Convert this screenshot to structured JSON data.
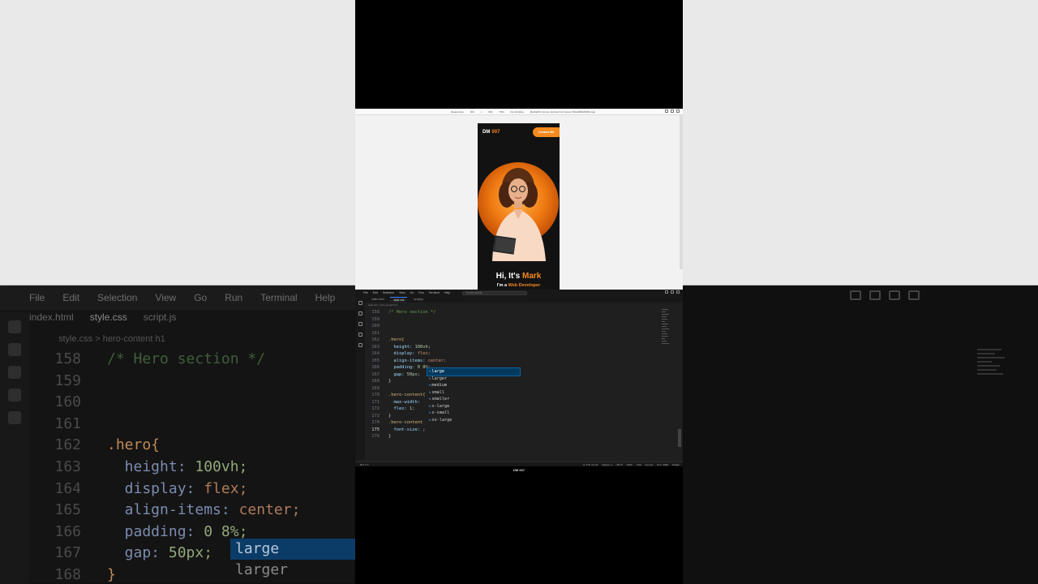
{
  "bg_zoom": {
    "menu": [
      "File",
      "Edit",
      "Selection",
      "View",
      "Go",
      "Run",
      "Terminal",
      "Help"
    ],
    "tabs": [
      "index.html",
      "style.css",
      "script.js"
    ],
    "crumb": "style.css > hero-content h1",
    "lines": [
      {
        "n": "158",
        "code": "/* Hero section */"
      },
      {
        "n": "159",
        "code": ""
      },
      {
        "n": "160",
        "code": ""
      },
      {
        "n": "161",
        "code": ""
      },
      {
        "n": "162",
        "code": ".hero{"
      },
      {
        "n": "163",
        "prop": "height",
        "val": "100vh;"
      },
      {
        "n": "164",
        "prop": "display",
        "val": "flex;"
      },
      {
        "n": "165",
        "prop": "align-items",
        "val": "center;"
      },
      {
        "n": "166",
        "prop": "padding",
        "val": "0 8%;"
      },
      {
        "n": "167",
        "prop": "gap",
        "val": "50px;"
      },
      {
        "n": "168",
        "code": "}"
      }
    ],
    "suggestions": [
      "large",
      "larger"
    ]
  },
  "devtools": {
    "device": "Responsive",
    "width": "364",
    "x": "×",
    "height": "834",
    "zoom": "75%",
    "throttle": "No throttling",
    "ua": "Mozilla/5.0 (Linux; Android 6.0; Nexus 5 Build/MRA58N) App"
  },
  "site": {
    "logo_prefix": "DM",
    "logo_highlight": "007",
    "contact_button": "Contact Me",
    "hero_title_prefix": "Hi, It's",
    "hero_title_name": "Mark",
    "hero_role_prefix": "I'm a",
    "hero_role_highlight": "Web Developer"
  },
  "editor": {
    "menu": [
      "File",
      "Edit",
      "Selection",
      "View",
      "Go",
      "Run",
      "Terminal",
      "Help"
    ],
    "search_placeholder": "Portfolio Website",
    "tabs": [
      "index.html",
      "style.css",
      "script.js"
    ],
    "crumb": "style.css > hero-content h1",
    "lines": [
      {
        "n": "158",
        "parts": [
          {
            "t": "cm",
            "v": "/* Hero section */"
          }
        ]
      },
      {
        "n": "159",
        "parts": []
      },
      {
        "n": "160",
        "parts": []
      },
      {
        "n": "161",
        "parts": []
      },
      {
        "n": "162",
        "parts": [
          {
            "t": "sel",
            "v": ".hero{"
          }
        ]
      },
      {
        "n": "163",
        "parts": [
          {
            "t": "prop",
            "v": "  height: "
          },
          {
            "t": "num",
            "v": "100vh;"
          }
        ]
      },
      {
        "n": "164",
        "parts": [
          {
            "t": "prop",
            "v": "  display: "
          },
          {
            "t": "val",
            "v": "flex;"
          }
        ]
      },
      {
        "n": "165",
        "parts": [
          {
            "t": "prop",
            "v": "  align-items: "
          },
          {
            "t": "val",
            "v": "center;"
          }
        ]
      },
      {
        "n": "166",
        "parts": [
          {
            "t": "prop",
            "v": "  padding: "
          },
          {
            "t": "num",
            "v": "0 8%;"
          }
        ]
      },
      {
        "n": "167",
        "parts": [
          {
            "t": "prop",
            "v": "  gap: "
          },
          {
            "t": "num",
            "v": "50px;"
          }
        ]
      },
      {
        "n": "168",
        "parts": [
          {
            "t": "",
            "v": "}"
          }
        ]
      },
      {
        "n": "169",
        "parts": []
      },
      {
        "n": "170",
        "parts": [
          {
            "t": "sel",
            "v": ".hero-content{"
          }
        ]
      },
      {
        "n": "171",
        "parts": [
          {
            "t": "prop",
            "v": "  max-width: "
          }
        ]
      },
      {
        "n": "172",
        "parts": [
          {
            "t": "prop",
            "v": "  flex: "
          },
          {
            "t": "num",
            "v": "1;"
          }
        ]
      },
      {
        "n": "173",
        "parts": [
          {
            "t": "",
            "v": "}"
          }
        ]
      },
      {
        "n": "174",
        "parts": [
          {
            "t": "sel",
            "v": ".hero-content"
          }
        ]
      },
      {
        "n": "175",
        "parts": [
          {
            "t": "prop",
            "v": "  font-size: "
          },
          {
            "t": "",
            "v": ";"
          }
        ],
        "current": true
      },
      {
        "n": "176",
        "parts": [
          {
            "t": "",
            "v": "}"
          }
        ]
      }
    ],
    "suggestions": [
      "large",
      "larger",
      "medium",
      "small",
      "smaller",
      "x-large",
      "x-small",
      "xx-large"
    ],
    "status_left": "⊗ 0 ⚠ 0",
    "status_right": [
      "Ln 175, Col 15",
      "Spaces: 4",
      "UTF-8",
      "CRLF",
      "CSS",
      "Go Live",
      "Port : 5500",
      "Prettier"
    ]
  },
  "channel": "DM 007"
}
